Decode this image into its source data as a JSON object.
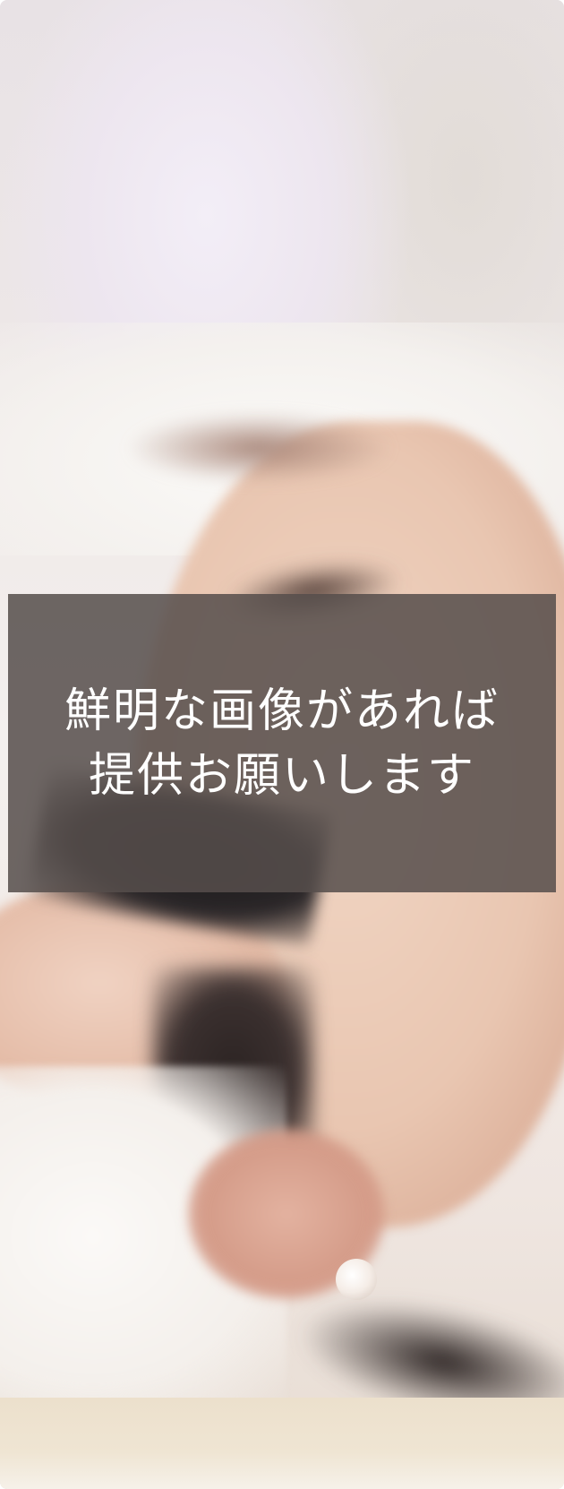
{
  "notice": {
    "line1": "鮮明な画像があれば",
    "line2": "提供お願いします"
  },
  "colors": {
    "overlay": "#564e4c",
    "text": "#ffffff"
  }
}
